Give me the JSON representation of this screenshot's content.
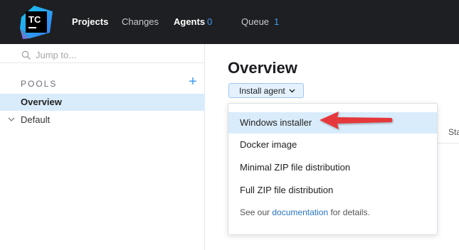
{
  "logo": {
    "text": "TC",
    "icon": "teamcity-logo"
  },
  "nav": {
    "projects": "Projects",
    "changes": "Changes",
    "agents": "Agents",
    "agents_count": "0",
    "queue": "Queue",
    "queue_count": "1"
  },
  "sidebar": {
    "search_placeholder": "Jump to...",
    "section_label": "POOLS",
    "add_symbol": "+",
    "items": [
      {
        "label": "Overview",
        "selected": true
      },
      {
        "label": "Default",
        "selected": false
      }
    ]
  },
  "main": {
    "title": "Overview",
    "install_button": "Install agent",
    "partial_column_header": "Sta"
  },
  "dropdown": {
    "items": [
      {
        "label": "Windows installer",
        "selected": true
      },
      {
        "label": "Docker image",
        "selected": false
      },
      {
        "label": "Minimal ZIP file distribution",
        "selected": false
      },
      {
        "label": "Full ZIP file distribution",
        "selected": false
      }
    ],
    "note_prefix": "See our ",
    "note_link": "documentation",
    "note_suffix": " for details."
  },
  "colors": {
    "topbar_bg": "#1e1f22",
    "accent": "#3d9df2",
    "selection_bg": "#d9ecfb",
    "annotation_arrow": "#e5383b"
  }
}
